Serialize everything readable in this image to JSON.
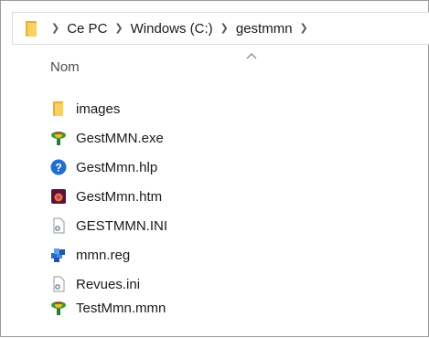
{
  "breadcrumb": {
    "items": [
      "Ce PC",
      "Windows (C:)",
      "gestmmn"
    ]
  },
  "list_header": {
    "name_column": "Nom"
  },
  "files": [
    {
      "name": "images",
      "icon": "folder-icon"
    },
    {
      "name": "GestMMN.exe",
      "icon": "app-exe-icon"
    },
    {
      "name": "GestMmn.hlp",
      "icon": "help-file-icon"
    },
    {
      "name": "GestMmn.htm",
      "icon": "html-file-icon"
    },
    {
      "name": "GESTMMN.INI",
      "icon": "config-file-icon"
    },
    {
      "name": "mmn.reg",
      "icon": "registry-file-icon"
    },
    {
      "name": "Revues.ini",
      "icon": "config-file-icon"
    },
    {
      "name": "TestMmn.mmn",
      "icon": "mmn-file-icon"
    }
  ],
  "colors": {
    "folder": "#f8d162",
    "help": "#1f6fd0",
    "html": "#8a1a5a",
    "registry": "#2a6ac9"
  }
}
